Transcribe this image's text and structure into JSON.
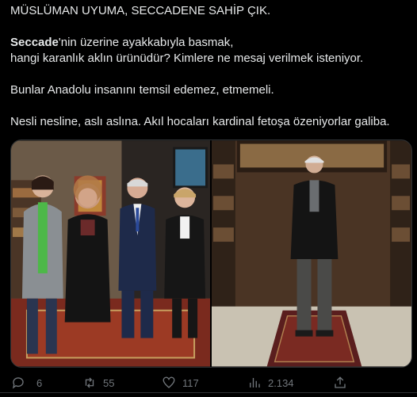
{
  "tweet": {
    "line1": "MÜSLÜMAN UYUMA, SECCADENE SAHİP ÇIK.",
    "line2_bold": "Seccade",
    "line2_rest": "'nin üzerine ayakkabıyla basmak,",
    "line3": "hangi karanlık aklın ürünüdür? Kimlere ne mesaj verilmek isteniyor.",
    "line4": "Bunlar Anadolu insanını temsil edemez, etmemeli.",
    "line5": "Nesli nesline, aslı aslına. Akıl hocaları kardinal fetoşa özeniyorlar galiba."
  },
  "media": {
    "left_photo": "four people standing on a patterned rug in a room",
    "right_photo": "man in dark suit standing on a prayer rug in front of bookshelves"
  },
  "actions": {
    "replies": "6",
    "retweets": "55",
    "likes": "117",
    "views": "2.134"
  },
  "icons": [
    "reply-icon",
    "retweet-icon",
    "like-icon",
    "views-icon",
    "share-icon"
  ]
}
